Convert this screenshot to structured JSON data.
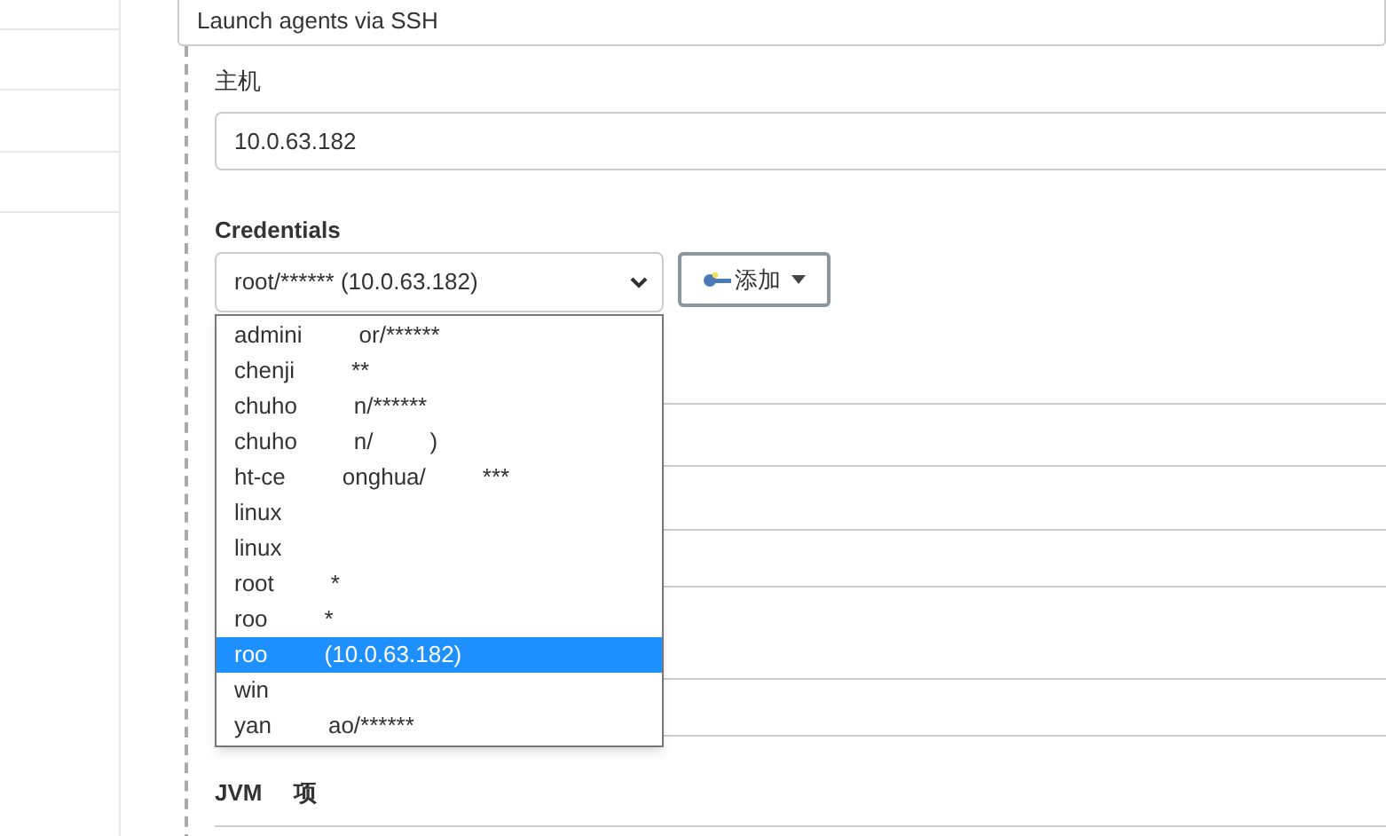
{
  "launch_method": {
    "value": "Launch agents via SSH"
  },
  "host": {
    "label": "主机",
    "value": "10.0.63.182"
  },
  "credentials": {
    "label": "Credentials",
    "value": "root/****** (10.0.63.182)",
    "add_button": "添加",
    "options": [
      {
        "parts": [
          "admini",
          "or/******"
        ],
        "selected": false
      },
      {
        "parts": [
          "chenji",
          "**"
        ],
        "selected": false
      },
      {
        "parts": [
          "chuho",
          "n/******"
        ],
        "selected": false
      },
      {
        "parts": [
          "chuho",
          "n/",
          ")"
        ],
        "selected": false
      },
      {
        "parts": [
          "ht-ce",
          "onghua/",
          "***"
        ],
        "selected": false
      },
      {
        "parts": [
          "linux"
        ],
        "selected": false
      },
      {
        "parts": [
          "linux"
        ],
        "selected": false
      },
      {
        "parts": [
          "root",
          "*"
        ],
        "selected": false
      },
      {
        "parts": [
          "roo",
          "*"
        ],
        "selected": false
      },
      {
        "parts": [
          "roo",
          "(10.0.63.182)"
        ],
        "selected": true
      },
      {
        "parts": [
          "win"
        ],
        "selected": false
      },
      {
        "parts": [
          "yan",
          "ao/******"
        ],
        "selected": false
      }
    ]
  },
  "jvm": {
    "label_parts": [
      "JVM",
      "项"
    ]
  }
}
